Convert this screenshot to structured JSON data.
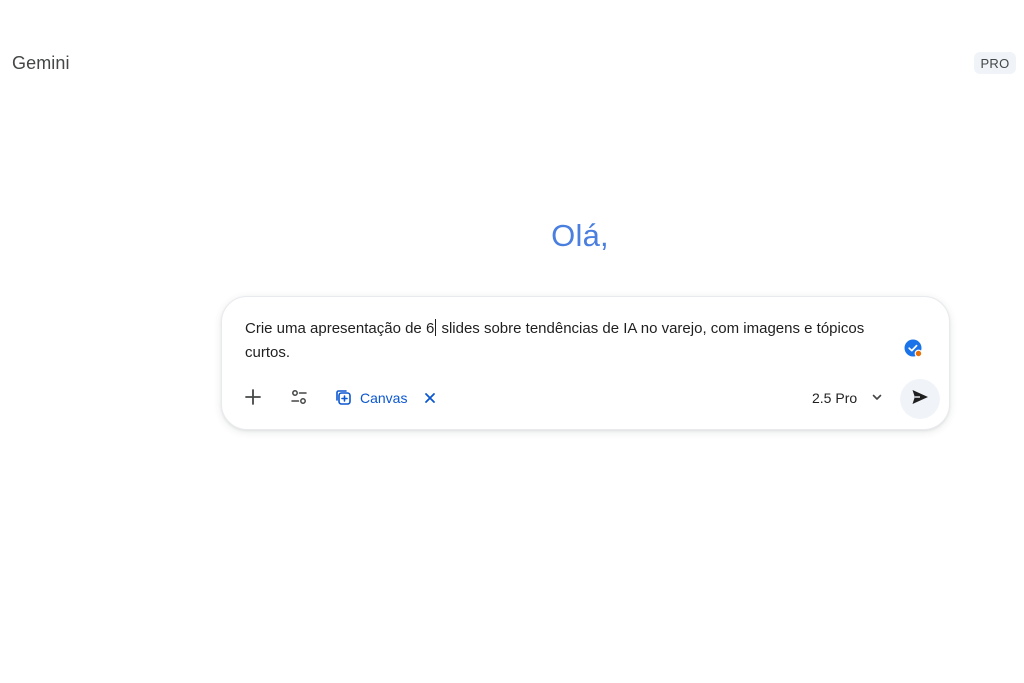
{
  "app": {
    "title": "Gemini",
    "plan_badge": "PRO"
  },
  "greeting": "Olá,",
  "prompt": {
    "text_before_caret": "Crie uma apresentação de 6",
    "text_after_caret": " slides sobre tendências de IA no varejo, com imagens e tópicos curtos."
  },
  "toolbar": {
    "add_icon": "plus-icon",
    "tools_icon": "tools-sliders-icon",
    "canvas_chip_label": "Canvas",
    "canvas_icon": "canvas-icon",
    "canvas_close_icon": "close-icon",
    "model_label": "2.5 Pro",
    "model_dropdown_icon": "chevron-down-icon",
    "send_icon": "send-icon"
  },
  "colors": {
    "greeting": "#4a7fe0",
    "canvas_chip": "#0b57d0",
    "check_badge": "#1a73e8",
    "status_dot": "#e8710a",
    "send_bg": "#f0f4f9"
  }
}
